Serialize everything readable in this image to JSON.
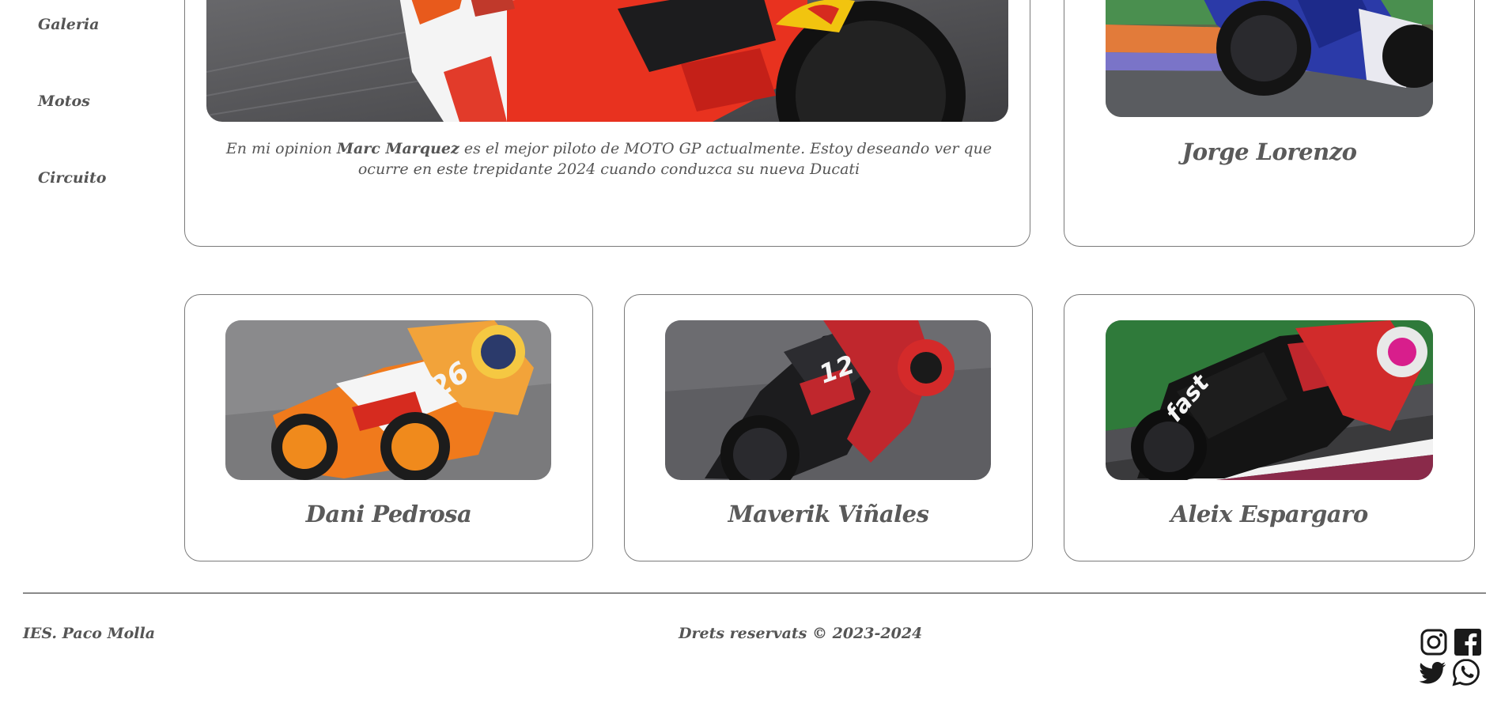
{
  "nav": {
    "items": [
      "Galeria",
      "Motos",
      "Circuito"
    ]
  },
  "featured": {
    "caption_prefix": "En mi opinion ",
    "caption_bold": "Marc Marquez",
    "caption_suffix": " es el mejor piloto de MOTO GP actualmente. Estoy deseando ver que ocurre en este trepidante 2024 cuando conduzca su nueva Ducati"
  },
  "riders": {
    "top_right": "Jorge Lorenzo",
    "row2": [
      "Dani Pedrosa",
      "Maverik Viñales",
      "Aleix Espargaro"
    ]
  },
  "footer": {
    "school": "IES. Paco Molla",
    "copyright": "Drets reservats © 2023-2024"
  },
  "social": [
    "instagram-icon",
    "facebook-icon",
    "twitter-icon",
    "whatsapp-icon"
  ],
  "colors": {
    "border": "#7a7a7a",
    "text": "#555555",
    "icon": "#1a1a1a"
  }
}
